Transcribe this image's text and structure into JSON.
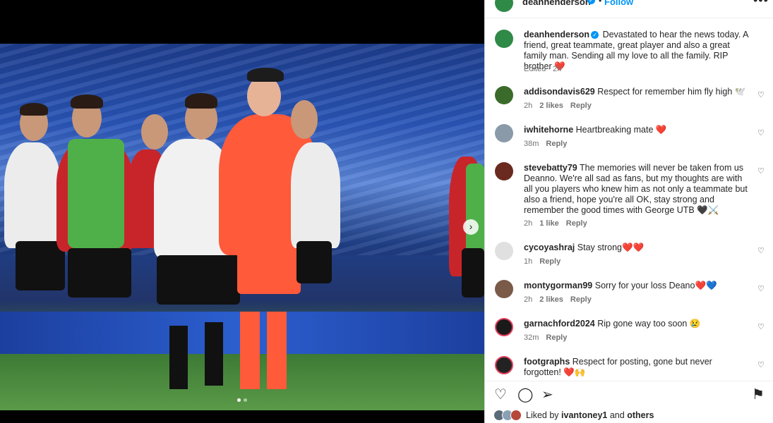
{
  "header": {
    "username": "deanhenderson",
    "dot": "•",
    "follow": "Follow",
    "more": "•••"
  },
  "caption": {
    "username": "deanhenderson",
    "text": "Devastated to hear the news today. A friend, great teammate, great player and also a great family man. Sending all my love to all the family. RIP brother ❤️",
    "edited": "Edited · 2h"
  },
  "comments": [
    {
      "username": "addisondavis629",
      "text": "Respect for remember him fly high 🕊️",
      "time": "2h",
      "likes": "2 likes",
      "reply": "Reply",
      "avatar_color": "#3b6b2b"
    },
    {
      "username": "iwhitehorne",
      "text": "Heartbreaking mate ❤️",
      "time": "38m",
      "likes": "",
      "reply": "Reply",
      "avatar_color": "#8a9aa8"
    },
    {
      "username": "stevebatty79",
      "text": "The memories will never be taken from us Deanno. We're all sad as fans, but my thoughts are with all you players who knew him as not only a teammate but also a friend, hope you're all OK, stay strong and remember the good times with George UTB 🖤⚔️",
      "time": "2h",
      "likes": "1 like",
      "reply": "Reply",
      "avatar_color": "#6b2a1f"
    },
    {
      "username": "cycoyashraj",
      "text": "Stay strong❤️❤️",
      "time": "1h",
      "likes": "",
      "reply": "Reply",
      "avatar_color": "#d9d9d9"
    },
    {
      "username": "montygorman99",
      "text": "Sorry for your loss Deano❤️💙",
      "time": "2h",
      "likes": "2 likes",
      "reply": "Reply",
      "avatar_color": "#7a5a48"
    },
    {
      "username": "garnachford2024",
      "text": "Rip gone way too soon 😢",
      "time": "32m",
      "likes": "",
      "reply": "Reply",
      "avatar_color": "#1a1a1a"
    },
    {
      "username": "footgraphs",
      "text": "Respect for posting, gone but never forgotten! ❤️🙌",
      "time": "",
      "likes": "",
      "reply": "",
      "avatar_color": "#222"
    }
  ],
  "liked_by": {
    "prefix": "Liked by",
    "user": "ivantoney1",
    "and": "and",
    "others": "others"
  },
  "icons": {
    "heart": "heart-icon",
    "comment": "comment-icon",
    "share": "share-icon",
    "save": "bookmark-icon",
    "next": "chevron-right-icon"
  },
  "colors": {
    "accent": "#0095f6",
    "text": "#262626",
    "muted": "#737373"
  }
}
